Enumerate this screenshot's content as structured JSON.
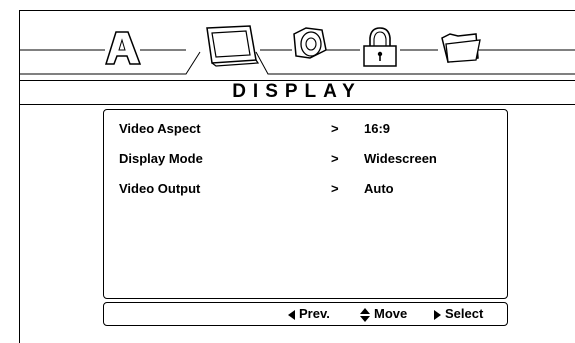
{
  "title": "DISPLAY",
  "tabs": [
    {
      "name": "language",
      "icon": "letter-a-icon",
      "selected": false
    },
    {
      "name": "display",
      "icon": "monitor-icon",
      "selected": true
    },
    {
      "name": "audio",
      "icon": "speaker-icon",
      "selected": false
    },
    {
      "name": "parental",
      "icon": "padlock-icon",
      "selected": false
    },
    {
      "name": "misc",
      "icon": "folder-icon",
      "selected": false
    }
  ],
  "menu": {
    "items": [
      {
        "label": "Video Aspect",
        "arrow": ">",
        "value": "16:9"
      },
      {
        "label": "Display Mode",
        "arrow": ">",
        "value": "Widescreen"
      },
      {
        "label": "Video Output",
        "arrow": ">",
        "value": "Auto"
      }
    ]
  },
  "help": {
    "prev": "Prev.",
    "move": "Move",
    "select": "Select"
  },
  "colors": {
    "foreground": "#000000",
    "background": "#ffffff"
  }
}
